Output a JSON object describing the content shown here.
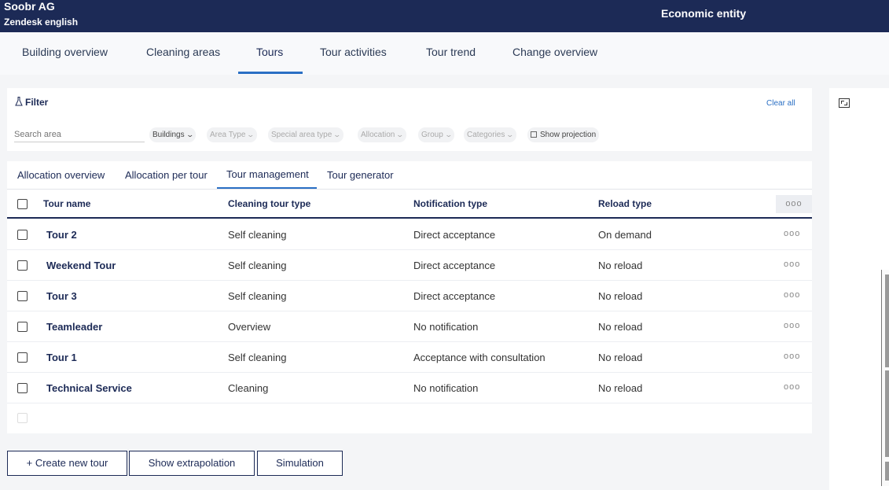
{
  "header": {
    "company": "Soobr AG",
    "subtitle": "Zendesk english",
    "entity": "Economic entity"
  },
  "nav": {
    "tabs": [
      "Building overview",
      "Cleaning areas",
      "Tours",
      "Tour activities",
      "Tour trend",
      "Change overview"
    ],
    "active": "Tours"
  },
  "filter": {
    "title": "Filter",
    "clear_label": "Clear all",
    "search_placeholder": "Search area",
    "chips": [
      "Buildings",
      "Area Type",
      "Special area type",
      "Allocation",
      "Group",
      "Categories"
    ],
    "projection_label": "Show projection"
  },
  "subtabs": {
    "items": [
      "Allocation overview",
      "Allocation per tour",
      "Tour management",
      "Tour generator"
    ],
    "active": "Tour management"
  },
  "table": {
    "columns": [
      "Tour name",
      "Cleaning tour type",
      "Notification type",
      "Reload type"
    ],
    "rows": [
      {
        "name": "Tour 2",
        "type": "Self cleaning",
        "notification": "Direct acceptance",
        "reload": "On demand"
      },
      {
        "name": "Weekend Tour",
        "type": "Self cleaning",
        "notification": "Direct acceptance",
        "reload": "No reload"
      },
      {
        "name": "Tour 3",
        "type": "Self cleaning",
        "notification": "Direct acceptance",
        "reload": "No reload"
      },
      {
        "name": "Teamleader",
        "type": "Overview",
        "notification": "No notification",
        "reload": "No reload"
      },
      {
        "name": "Tour 1",
        "type": "Self cleaning",
        "notification": "Acceptance with consultation",
        "reload": "No reload"
      },
      {
        "name": "Technical Service",
        "type": "Cleaning",
        "notification": "No notification",
        "reload": "No reload"
      }
    ],
    "more_glyph": "ooo"
  },
  "actions": {
    "create": "+ Create new tour",
    "extrapolation": "Show extrapolation",
    "simulation": "Simulation"
  },
  "colors": {
    "header_bg": "#1c2a56",
    "accent": "#2a6fc4"
  }
}
